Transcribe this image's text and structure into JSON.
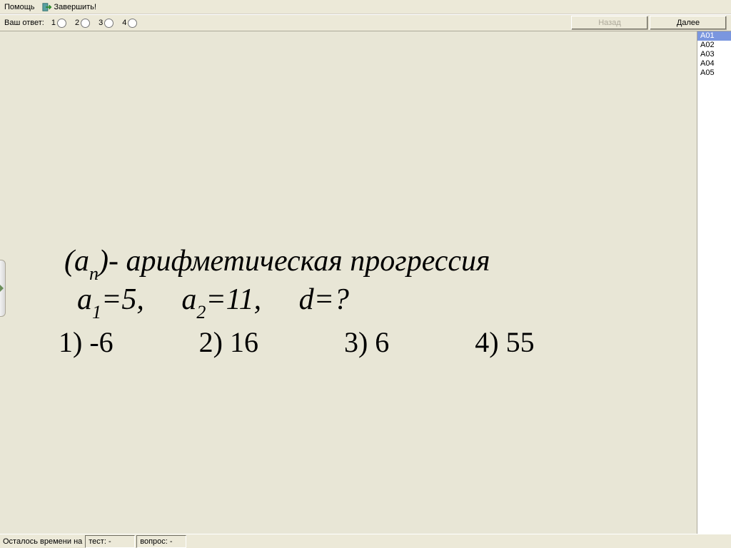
{
  "menu": {
    "help": "Помощь",
    "finish": "Завершить!"
  },
  "toolbar": {
    "answer_label": "Ваш ответ:",
    "options": [
      "1",
      "2",
      "3",
      "4"
    ],
    "back": "Назад",
    "next": "Далее"
  },
  "qlist": {
    "items": [
      "A01",
      "A02",
      "A03",
      "A04",
      "A05"
    ],
    "selected": "A01"
  },
  "question": {
    "line1_pre": "(a",
    "line1_sub": "n",
    "line1_post": ")- арифметическая прогрессия",
    "line2_a1var": "a",
    "line2_a1sub": "1",
    "line2_a1rest": "=5,",
    "line2_a2var": "a",
    "line2_a2sub": "2",
    "line2_a2rest": "=11,",
    "line2_d": "d=?",
    "answers": [
      "1) -6",
      "2) 16",
      "3) 6",
      "4) 55"
    ]
  },
  "status": {
    "time_label": "Осталось времени на",
    "test_label": "тест: -",
    "question_label": "вопрос: -"
  }
}
